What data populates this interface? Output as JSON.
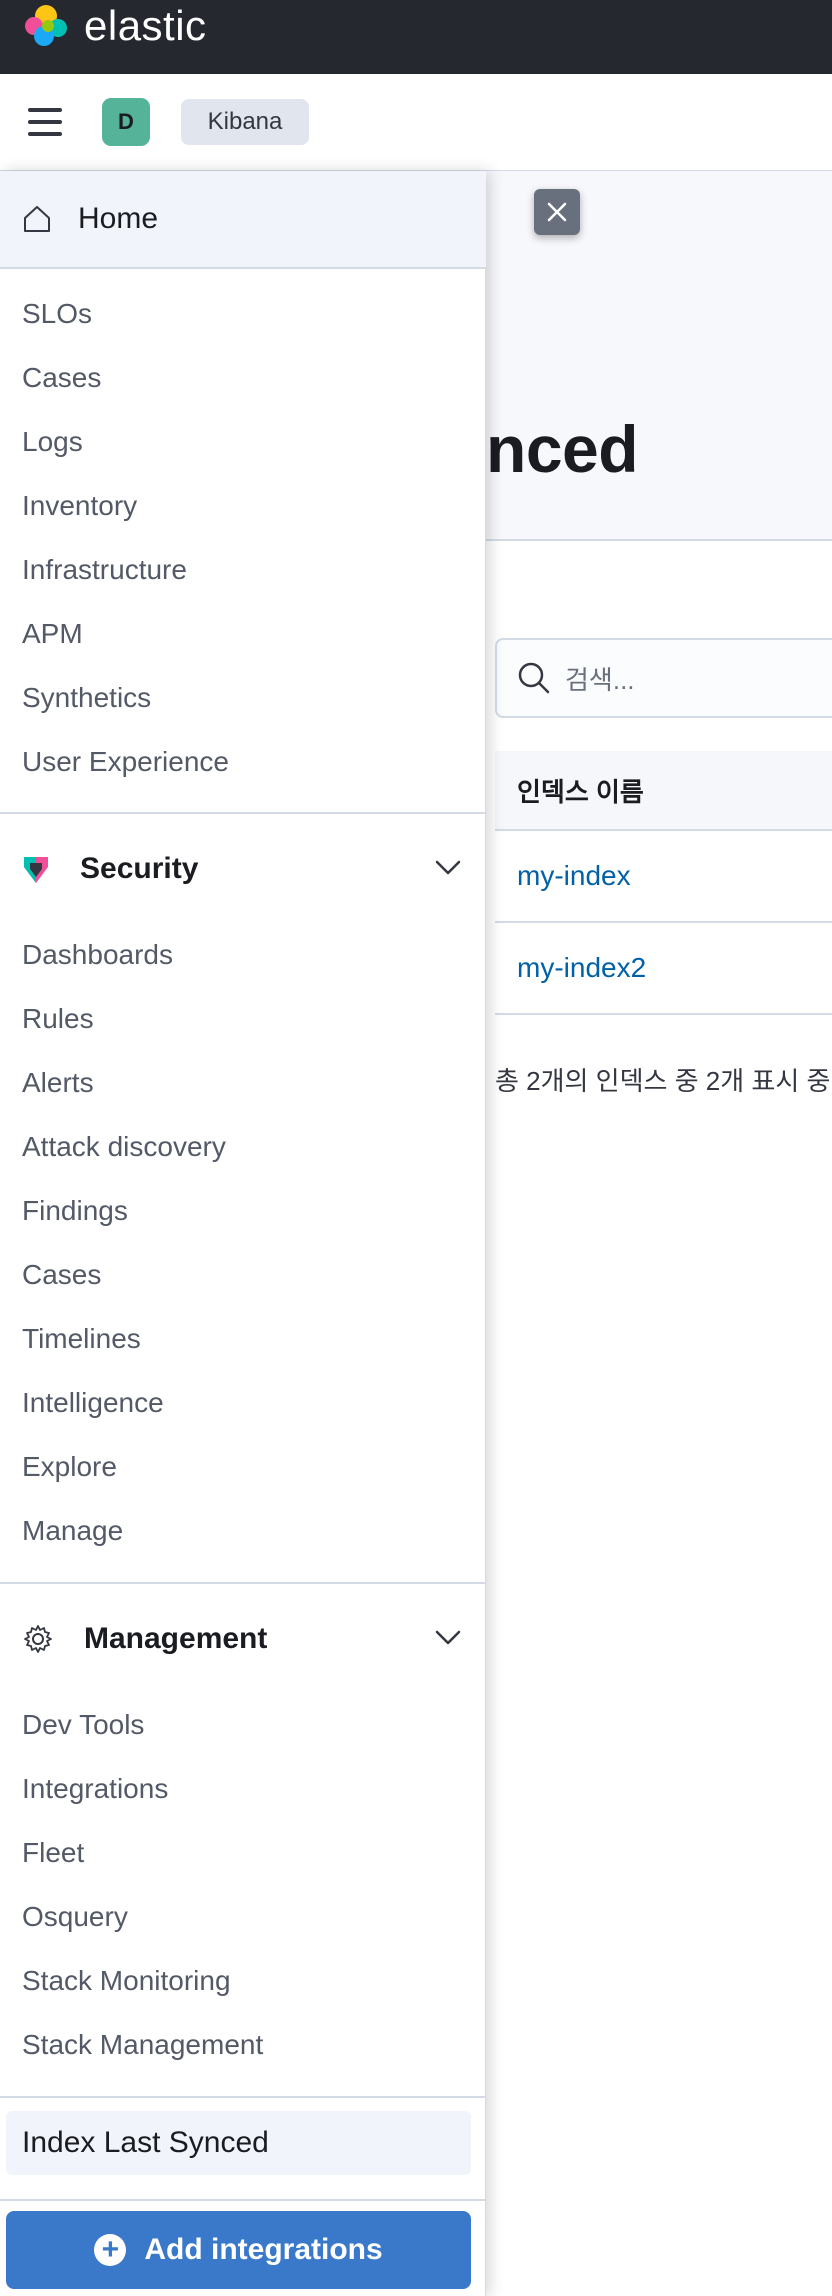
{
  "topbar": {
    "brand": "elastic"
  },
  "header": {
    "space_initial": "D",
    "breadcrumb": "Kibana"
  },
  "main": {
    "title_fragment": "nced",
    "search_placeholder": "검색...",
    "table": {
      "column_header": "인덱스 이름",
      "rows": [
        "my-index",
        "my-index2"
      ]
    },
    "pagination_text": "총 2개의 인덱스 중 2개 표시 중"
  },
  "nav": {
    "home": "Home",
    "observability_items": [
      "SLOs",
      "Cases",
      "Logs",
      "Inventory",
      "Infrastructure",
      "APM",
      "Synthetics",
      "User Experience"
    ],
    "security": {
      "label": "Security",
      "items": [
        "Dashboards",
        "Rules",
        "Alerts",
        "Attack discovery",
        "Findings",
        "Cases",
        "Timelines",
        "Intelligence",
        "Explore",
        "Manage"
      ]
    },
    "management": {
      "label": "Management",
      "items": [
        "Dev Tools",
        "Integrations",
        "Fleet",
        "Osquery",
        "Stack Monitoring",
        "Stack Management"
      ]
    },
    "recent_item": "Index Last Synced",
    "add_button": "Add integrations"
  }
}
